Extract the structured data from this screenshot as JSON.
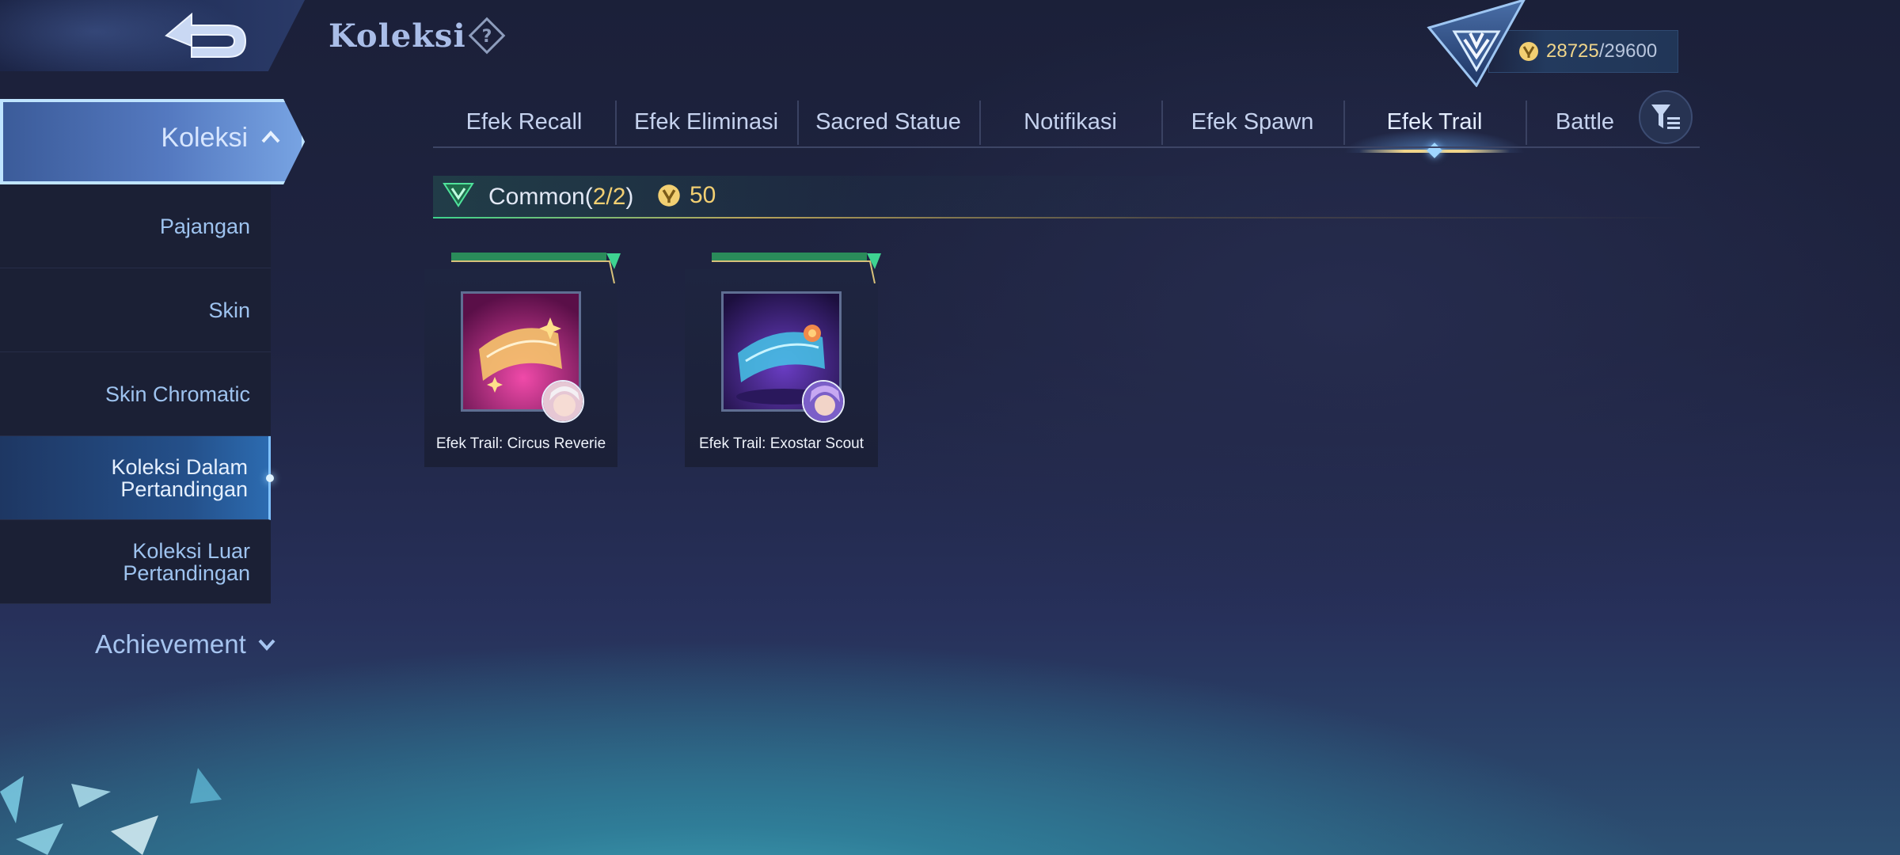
{
  "header": {
    "title": "Koleksi",
    "currency_current": "28725",
    "currency_separator": "/",
    "currency_max": "29600"
  },
  "sidebar": {
    "main_label": "Koleksi",
    "items": [
      {
        "label": "Pajangan"
      },
      {
        "label": "Skin"
      },
      {
        "label": "Skin Chromatic"
      },
      {
        "label": "Koleksi Dalam Pertandingan",
        "active": true
      },
      {
        "label": "Koleksi Luar Pertandingan"
      }
    ],
    "achievement_label": "Achievement"
  },
  "tabs": [
    {
      "label": "Efek Recall"
    },
    {
      "label": "Efek Eliminasi"
    },
    {
      "label": "Sacred Statue"
    },
    {
      "label": "Notifikasi"
    },
    {
      "label": "Efek Spawn"
    },
    {
      "label": "Efek Trail",
      "active": true
    },
    {
      "label": "Battle"
    }
  ],
  "section": {
    "rarity": "Common",
    "count_open": "(",
    "count": "2/2",
    "count_close": ")",
    "points": "50"
  },
  "cards": [
    {
      "name": "Efek Trail: Circus Reverie",
      "thumb_color": "#c2308f"
    },
    {
      "name": "Efek Trail: Exostar Scout",
      "thumb_color": "#4a2a8c"
    }
  ],
  "colors": {
    "accent_gold": "#f2cf72",
    "accent_blue": "#78a4e3",
    "common_green": "#3dd38c"
  },
  "icons": [
    "back-arrow-icon",
    "help-icon",
    "rank-emblem-icon",
    "coin-icon",
    "chevron-up-icon",
    "chevron-down-icon",
    "filter-icon",
    "common-rarity-icon"
  ]
}
